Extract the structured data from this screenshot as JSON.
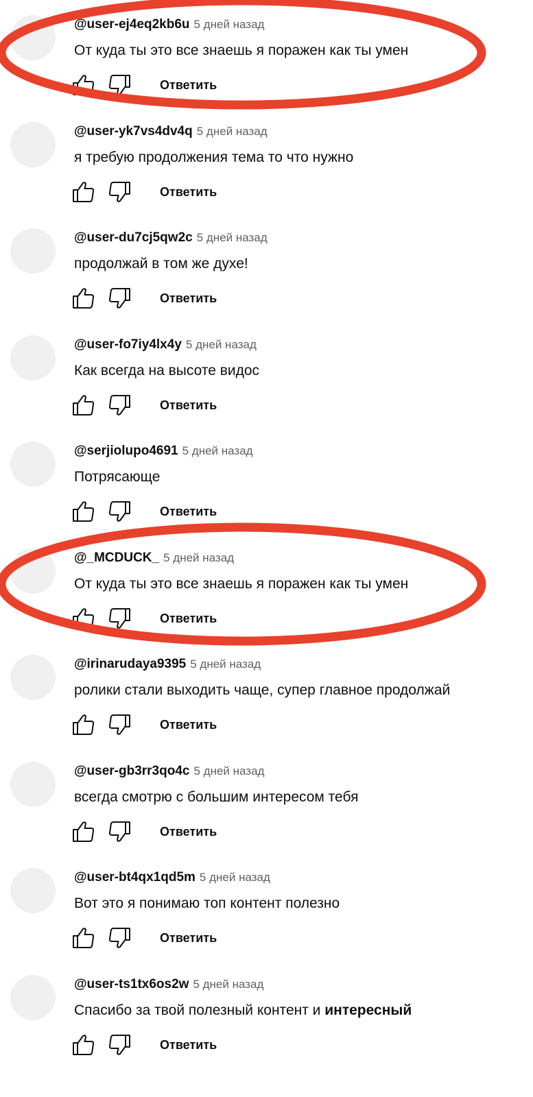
{
  "comments": [
    {
      "author": "@user-ej4eq2kb6u",
      "time": "5 дней назад",
      "text": "От куда ты это все знаешь я поражен как ты умен",
      "reply": "Ответить"
    },
    {
      "author": "@user-yk7vs4dv4q",
      "time": "5 дней назад",
      "text": "я требую продолжения тема то что нужно",
      "reply": "Ответить"
    },
    {
      "author": "@user-du7cj5qw2c",
      "time": "5 дней назад",
      "text": "продолжай в том же духе!",
      "reply": "Ответить"
    },
    {
      "author": "@user-fo7iy4lx4y",
      "time": "5 дней назад",
      "text": "Как всегда на высоте видос",
      "reply": "Ответить"
    },
    {
      "author": "@serjiolupo4691",
      "time": "5 дней назад",
      "text": "Потрясающе",
      "reply": "Ответить"
    },
    {
      "author": "@_MCDUCK_",
      "time": "5 дней назад",
      "text": "От куда ты это все знаешь я поражен как ты умен",
      "reply": "Ответить"
    },
    {
      "author": "@irinarudaya9395",
      "time": "5 дней назад",
      "text": "ролики стали выходить чаще, супер главное продолжай",
      "reply": "Ответить"
    },
    {
      "author": "@user-gb3rr3qo4c",
      "time": "5 дней назад",
      "text": "всегда смотрю с большим интересом тебя",
      "reply": "Ответить"
    },
    {
      "author": "@user-bt4qx1qd5m",
      "time": "5 дней назад",
      "text": "Вот это я понимаю топ контент полезно",
      "reply": "Ответить"
    },
    {
      "author": "@user-ts1tx6os2w",
      "time": "5 дней назад",
      "text": "Спасибо за твой полезный контент и",
      "text_bold": "интересный",
      "reply": "Ответить"
    }
  ],
  "highlight_color": "#e8412c",
  "avatar_color": "#f0f0f0",
  "secondary_text_color": "#606060"
}
